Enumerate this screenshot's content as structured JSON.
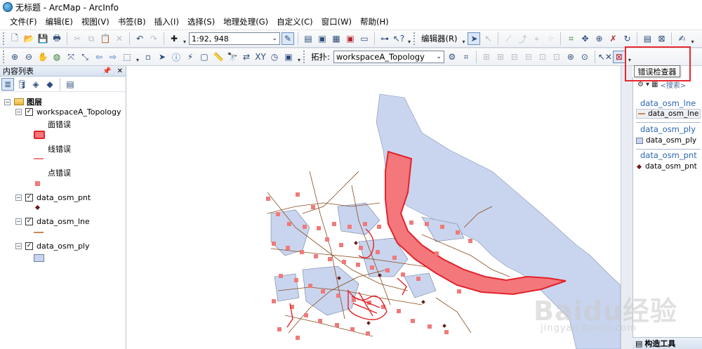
{
  "window": {
    "title": "无标题 - ArcMap - ArcInfo"
  },
  "menu": [
    "文件(F)",
    "编辑(E)",
    "视图(V)",
    "书签(B)",
    "插入(I)",
    "选择(S)",
    "地理处理(G)",
    "自定义(C)",
    "窗口(W)",
    "帮助(H)"
  ],
  "toolbar1": {
    "scale_value": "1:92, 948",
    "editor_label": "编辑器(R)"
  },
  "toolbar2": {
    "topology_label": "拓扑:",
    "topology_value": "workspaceA_Topology"
  },
  "tooltip": {
    "text": "错误检查器"
  },
  "toc": {
    "title": "内容列表",
    "layers_root": "图层",
    "items": [
      {
        "name": "workspaceA_Topology",
        "checked": true,
        "sublabels": [
          "面错误",
          "线错误",
          "点错误"
        ]
      },
      {
        "name": "data_osm_pnt",
        "checked": true
      },
      {
        "name": "data_osm_lne",
        "checked": true
      },
      {
        "name": "data_osm_ply",
        "checked": true
      }
    ]
  },
  "catalog": {
    "search_label": "<搜索>",
    "groups": [
      {
        "title": "data_osm_lne",
        "item": "data_osm_lne"
      },
      {
        "title": "data_osm_ply",
        "item": "data_osm_ply"
      },
      {
        "title": "data_osm_pnt",
        "item": "data_osm_pnt"
      }
    ],
    "footer": "构造工具"
  },
  "colors": {
    "polygon_fill": "#c9d5ef",
    "line_color": "#8a4a1e",
    "point_error": "#f07a7a",
    "polygon_error_fill": "#f4777c",
    "polygon_error_stroke": "#e3222a",
    "line_error": "#f08080",
    "point_symbol": "#6b1a1a",
    "highlight": "#e5282f"
  },
  "watermark": {
    "brand": "Baidu经验",
    "url": "jingyan.baidu.com"
  }
}
